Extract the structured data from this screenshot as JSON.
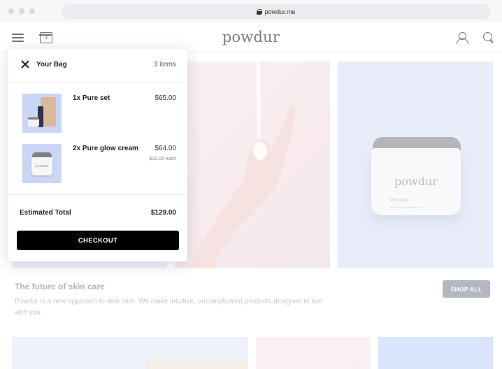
{
  "browser": {
    "url": "powdur.me"
  },
  "header": {
    "logo": "powdur",
    "cart_count": "3"
  },
  "cart": {
    "title": "Your Bag",
    "count_text": "3 items",
    "items": [
      {
        "name": "1x Pure set",
        "price": "$65.00",
        "each": ""
      },
      {
        "name": "2x Pure glow cream",
        "price": "$64.00",
        "each": "$32.00 each"
      }
    ],
    "total_label": "Estimated Total",
    "total_value": "$129.00",
    "checkout_label": "CHECKOUT"
  },
  "product_jar": {
    "brand": "powdur",
    "name": "Pure glow",
    "sub": "moisturizer + glow serum"
  },
  "thumb_brand": "powdur",
  "hero": {
    "title": "The future of skin care",
    "description": "Powdur is a new approach to skin care. We make intuitive, uncomplicated products designed to live with you.",
    "shop_all": "SHOP ALL"
  },
  "colors": {
    "accent_button": "#000000",
    "shop_all_bg": "#8a939e",
    "logo": "#7a7e86"
  },
  "icons": [
    "lock-icon",
    "hamburger-menu-icon",
    "cart-icon",
    "user-icon",
    "search-icon",
    "close-icon"
  ]
}
